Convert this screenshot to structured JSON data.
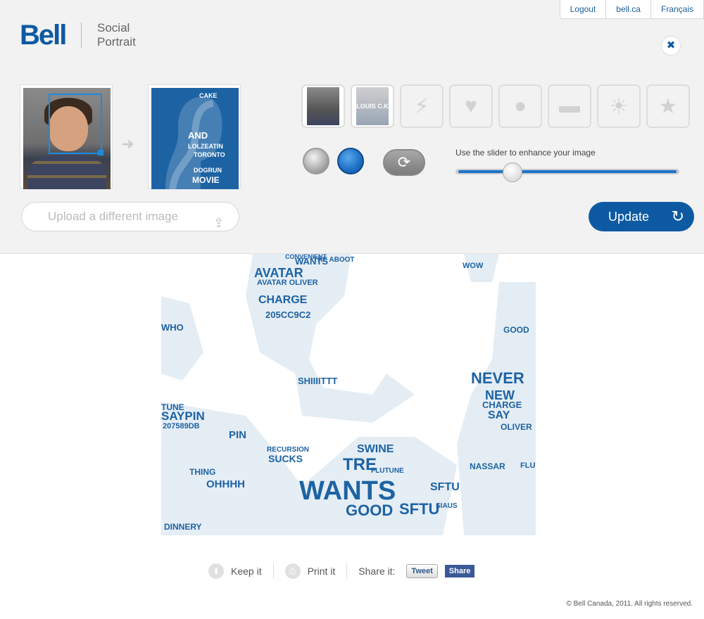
{
  "header": {
    "links": [
      "Logout",
      "bell.ca",
      "Français"
    ],
    "brand": "Bell",
    "app_name_line1": "Social",
    "app_name_line2": "Portrait",
    "close_symbol": "✖"
  },
  "editor": {
    "thumb_label": "LOUIS C.K",
    "slider_label": "Use the slider to enhance your image",
    "slider_value": 0.25,
    "upload_label": "Upload a different image",
    "update_label": "Update"
  },
  "preview_words": [
    "AND",
    "LOLZEATIN",
    "TORONTO",
    "MOVIE",
    "DOGRUN",
    "CAKE"
  ],
  "portrait_words": [
    "AVATAR",
    "AVATAR OLIVER",
    "CHARGE",
    "205CC9C2",
    "TUNE",
    "WANTS",
    "TRE ABOOT",
    "WOW",
    "NEVER",
    "NEW",
    "CHARGE",
    "SAY",
    "OLIVER",
    "GOOD",
    "SFTU",
    "WANTS",
    "TRE",
    "SWINE",
    "PIN",
    "OHHHH",
    "SAYPIN",
    "207589DB",
    "SHIIIITTT",
    "RECURSION",
    "SUCKS",
    "THING",
    "DINNERY",
    "GOOD",
    "SFTU",
    "NASSAR",
    "FLU",
    "WHO",
    "CONVENIENT",
    "FLUTUNE",
    "SIAUS"
  ],
  "actions": {
    "keep": "Keep it",
    "print": "Print it",
    "share": "Share it:",
    "tweet": "Tweet",
    "facebook": "Share"
  },
  "footer": "© Bell Canada, 2011. All rights reserved."
}
